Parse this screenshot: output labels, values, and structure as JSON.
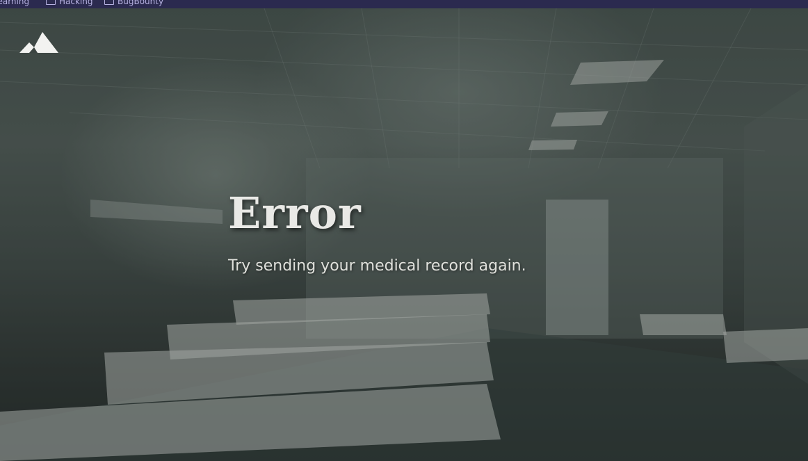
{
  "bookmarks": [
    {
      "label": "Learning",
      "icon": "folder-icon"
    },
    {
      "label": "Hacking",
      "icon": "folder-icon"
    },
    {
      "label": "BugBounty",
      "icon": "folder-icon"
    }
  ],
  "header": {
    "logo_icon": "mountain-icon"
  },
  "main": {
    "title": "Error",
    "message": "Try sending your medical record again."
  },
  "colors": {
    "bookmarks_bar": "#2b2a4f",
    "text": "#e9e9e6",
    "background": "#2b3230"
  }
}
